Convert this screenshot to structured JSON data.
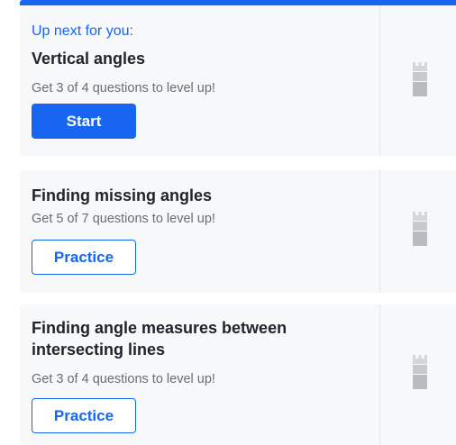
{
  "cards": [
    {
      "eyebrow": "Up next for you:",
      "title": "Vertical angles",
      "subtitle": "Get 3 of 4 questions to level up!",
      "button_label": "Start",
      "mastery_icon": "tower-icon"
    },
    {
      "title": "Finding missing angles",
      "subtitle": "Get 5 of 7 questions to level up!",
      "button_label": "Practice",
      "mastery_icon": "tower-icon"
    },
    {
      "title": "Finding angle measures between intersecting lines",
      "subtitle": "Get 3 of 4 questions to level up!",
      "button_label": "Practice",
      "mastery_icon": "tower-icon"
    }
  ],
  "colors": {
    "accent": "#1865f2",
    "card_background": "#f7f8fa",
    "title_text": "#21242c",
    "subtitle_text": "#6b6d73",
    "icon_gray": "#c7c9cc"
  }
}
